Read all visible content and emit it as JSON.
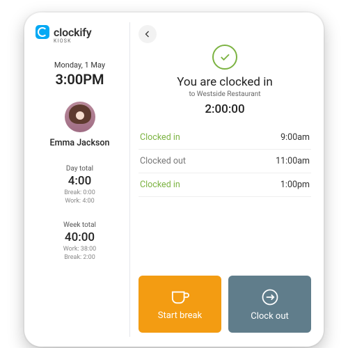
{
  "brand": {
    "name": "clockify",
    "sub": "KIOSK"
  },
  "date": {
    "label": "Monday, 1 May",
    "time": "3:00PM"
  },
  "user": {
    "name": "Emma Jackson"
  },
  "stats": {
    "day": {
      "label": "Day total",
      "value": "4:00",
      "break": "Break: 0:00",
      "work": "Work: 4:00"
    },
    "week": {
      "label": "Week total",
      "value": "40:00",
      "work": "Work: 38:00",
      "break": "Break: 2:00"
    }
  },
  "status": {
    "title": "You are clocked in",
    "sub": "to Westside Restaurant",
    "elapsed": "2:00:00"
  },
  "log": [
    {
      "label": "Clocked in",
      "type": "in",
      "time": "9:00am"
    },
    {
      "label": "Clocked out",
      "type": "out",
      "time": "11:00am"
    },
    {
      "label": "Clocked in",
      "type": "in",
      "time": "1:00pm"
    }
  ],
  "actions": {
    "break": "Start break",
    "clockout": "Clock out"
  }
}
